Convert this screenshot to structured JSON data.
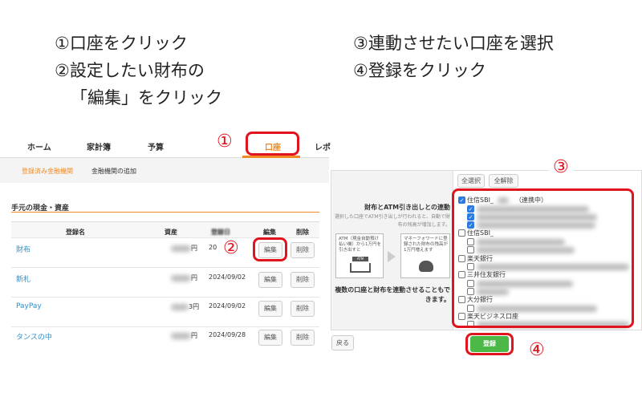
{
  "instructions": {
    "left": [
      "①口座をクリック",
      "②設定したい財布の",
      "「編集」をクリック"
    ],
    "right": [
      "③連動させたい口座を選択",
      "④登録をクリック"
    ]
  },
  "markers": {
    "m1": "①",
    "m2": "②",
    "m3": "③",
    "m4": "④"
  },
  "nav": {
    "tabs": [
      "ホーム",
      "家計簿",
      "予算",
      "口座",
      "レポ"
    ],
    "active": "口座"
  },
  "subnav": {
    "items": [
      "登録済み金融機関",
      "金融機関の追加"
    ]
  },
  "section": {
    "title": "手元の現金・資産"
  },
  "table": {
    "headers": [
      "登録名",
      "資産",
      "登録日",
      "編集",
      "削除"
    ],
    "rows": [
      {
        "name": "財布",
        "asset": "円",
        "date": "20"
      },
      {
        "name": "新札",
        "asset": "円",
        "date": "2024/09/02"
      },
      {
        "name": "PayPay",
        "asset": "3円",
        "date": "2024/09/02"
      },
      {
        "name": "タンスの中",
        "asset": "円",
        "date": "2024/09/28"
      }
    ],
    "edit_label": "編集",
    "delete_label": "削除"
  },
  "dialog": {
    "info_title": "財布とATM引き出しとの連動",
    "info_desc": "選択した口座でATM引き出しが行われると、自動で財布の残高が増加します。",
    "atm_text": "ATM（現金自動預け払い機）から1万円を引き出すと",
    "atm_label": "ATM",
    "mf_text": "マネーフォワードに登録された財布の残高が1万円増えます",
    "multi_text": "複数の口座と財布を連動させることもできます。",
    "select_all": "全選択",
    "deselect_all": "全解除",
    "accounts": [
      {
        "name": "住信SBI_",
        "status": "（連携中）",
        "checked": true,
        "subs": [
          true,
          true,
          true
        ]
      },
      {
        "name": "住信SBI_",
        "checked": false,
        "subs": [
          false,
          false
        ]
      },
      {
        "name": "楽天銀行",
        "checked": false,
        "subs": [
          false
        ]
      },
      {
        "name": "三井住友銀行",
        "checked": false,
        "subs": [
          false,
          false
        ]
      },
      {
        "name": "大分銀行",
        "checked": false,
        "subs": [
          false
        ]
      },
      {
        "name": "楽天ビジネス口座",
        "checked": false,
        "subs": [
          false
        ]
      }
    ],
    "back_label": "戻る",
    "register_label": "登録"
  },
  "colors": {
    "accent": "#f08a24",
    "marker": "#e0141e",
    "register": "#4cb848",
    "link": "#2a8fd0"
  }
}
